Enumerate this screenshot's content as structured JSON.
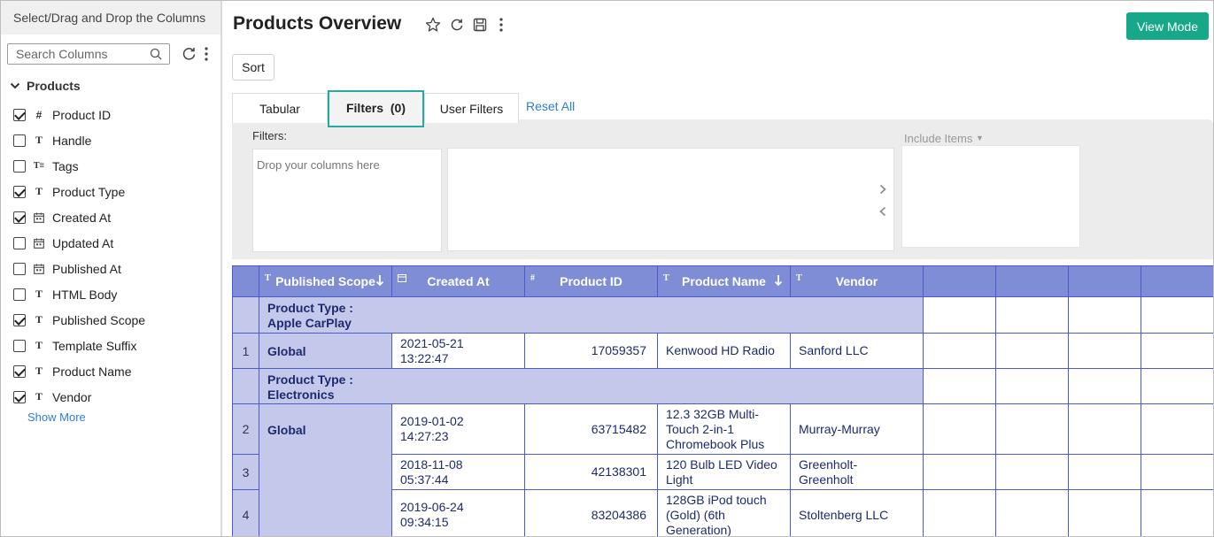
{
  "sidebar": {
    "header": "Select/Drag and Drop the Columns",
    "search_placeholder": "Search Columns",
    "group": "Products",
    "columns": [
      {
        "label": "Product ID",
        "checked": true,
        "type": "number"
      },
      {
        "label": "Handle",
        "checked": false,
        "type": "text"
      },
      {
        "label": "Tags",
        "checked": false,
        "type": "multitext"
      },
      {
        "label": "Product Type",
        "checked": true,
        "type": "text"
      },
      {
        "label": "Created At",
        "checked": true,
        "type": "date"
      },
      {
        "label": "Updated At",
        "checked": false,
        "type": "date"
      },
      {
        "label": "Published At",
        "checked": false,
        "type": "date"
      },
      {
        "label": "HTML Body",
        "checked": false,
        "type": "text"
      },
      {
        "label": "Published Scope",
        "checked": true,
        "type": "text"
      },
      {
        "label": "Template Suffix",
        "checked": false,
        "type": "text"
      },
      {
        "label": "Product Name",
        "checked": true,
        "type": "text"
      },
      {
        "label": "Vendor",
        "checked": true,
        "type": "text"
      }
    ],
    "show_more": "Show More"
  },
  "header": {
    "title": "Products Overview",
    "view_mode": "View Mode",
    "sort": "Sort"
  },
  "tabs": {
    "tabular": "Tabular",
    "filters": "Filters",
    "filters_count": "(0)",
    "user_filters": "User Filters",
    "reset_all": "Reset All"
  },
  "filter_panel": {
    "label": "Filters:",
    "drop_placeholder": "Drop your columns here",
    "include_items": "Include Items"
  },
  "table": {
    "headers": {
      "published_scope": "Published Scope",
      "created_at": "Created At",
      "product_id": "Product ID",
      "product_name": "Product Name",
      "vendor": "Vendor"
    },
    "groups": [
      {
        "label_line1": "Product Type :",
        "label_line2": "Apple CarPlay"
      },
      {
        "label_line1": "Product Type :",
        "label_line2": "Electronics"
      }
    ],
    "rows": [
      {
        "n": "1",
        "scope": "Global",
        "created_date": "2021-05-21",
        "created_time": "13:22:47",
        "product_id": "17059357",
        "name_lines": [
          "Kenwood HD Radio"
        ],
        "vendor_lines": [
          "Sanford LLC"
        ]
      },
      {
        "n": "2",
        "scope": "Global",
        "created_date": "2019-01-02",
        "created_time": "14:27:23",
        "product_id": "63715482",
        "name_lines": [
          "12.3 32GB Multi-",
          "Touch 2-in-1",
          "Chromebook Plus"
        ],
        "vendor_lines": [
          "Murray-Murray"
        ]
      },
      {
        "n": "3",
        "scope": "",
        "created_date": "2018-11-08",
        "created_time": "05:37:44",
        "product_id": "42138301",
        "name_lines": [
          "120 Bulb LED Video",
          "Light"
        ],
        "vendor_lines": [
          "Greenholt-",
          "Greenholt"
        ]
      },
      {
        "n": "4",
        "scope": "",
        "created_date": "2019-06-24",
        "created_time": "09:34:15",
        "product_id": "83204386",
        "name_lines": [
          "128GB iPod touch",
          "(Gold) (6th",
          "Generation)"
        ],
        "vendor_lines": [
          "Stoltenberg LLC"
        ]
      }
    ]
  },
  "colors": {
    "accent": "#16a889",
    "header_bg": "#7f8dd6",
    "group_bg": "#c4c9eb",
    "link": "#2a7fd8"
  }
}
